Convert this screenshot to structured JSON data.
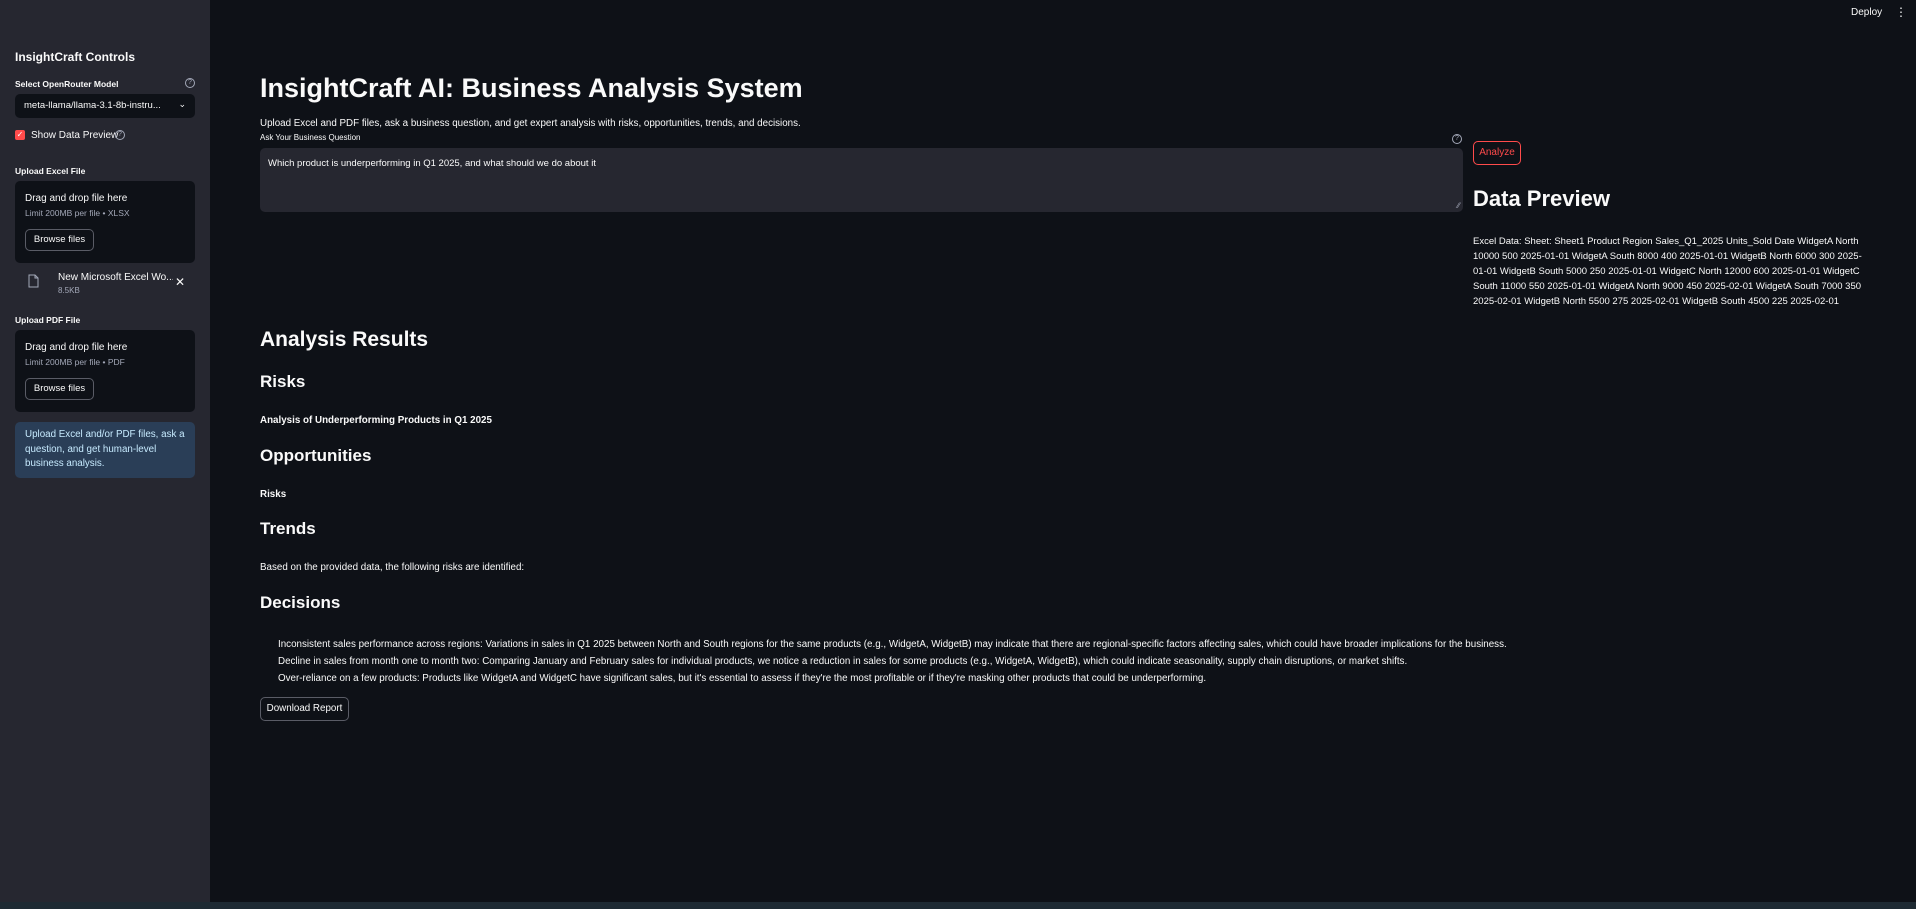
{
  "sidebar": {
    "title": "InsightCraft Controls",
    "model_label": "Select OpenRouter Model",
    "model_value": "meta-llama/llama-3.1-8b-instru...",
    "show_preview_label": "Show Data Preview",
    "show_preview_checked": true,
    "excel_label": "Upload Excel File",
    "excel_dropzone_title": "Drag and drop file here",
    "excel_dropzone_limit": "Limit 200MB per file • XLSX",
    "browse_label": "Browse files",
    "uploaded_file_name": "New Microsoft Excel Wo...",
    "uploaded_file_size": "8.5KB",
    "pdf_label": "Upload PDF File",
    "pdf_dropzone_title": "Drag and drop file here",
    "pdf_dropzone_limit": "Limit 200MB per file • PDF",
    "info_text": "Upload Excel and/or PDF files, ask a question, and get human-level business analysis."
  },
  "header": {
    "deploy_label": "Deploy"
  },
  "main": {
    "title": "InsightCraft AI: Business Analysis System",
    "subtitle": "Upload Excel and PDF files, ask a business question, and get expert analysis with risks, opportunities, trends, and decisions.",
    "question_label": "Ask Your Business Question",
    "question_value": "Which product is underperforming in Q1 2025, and what should we do about it",
    "analyze_label": "Analyze",
    "data_preview_title": "Data Preview",
    "data_preview_text": "Excel Data: Sheet: Sheet1 Product Region Sales_Q1_2025 Units_Sold Date WidgetA North 10000 500 2025-01-01 WidgetA South 8000 400 2025-01-01 WidgetB North 6000 300 2025-01-01 WidgetB South 5000 250 2025-01-01 WidgetC North 12000 600 2025-01-01 WidgetC South 11000 550 2025-01-01 WidgetA North 9000 450 2025-02-01 WidgetA South 7000 350 2025-02-01 WidgetB North 5500 275 2025-02-01 WidgetB South 4500 225 2025-02-01",
    "results_title": "Analysis Results",
    "risks_title": "Risks",
    "risks_text": "Analysis of Underperforming Products in Q1 2025",
    "opportunities_title": "Opportunities",
    "opportunities_text": "Risks",
    "trends_title": "Trends",
    "trends_text": "Based on the provided data, the following risks are identified:",
    "decisions_title": "Decisions",
    "decisions_items": [
      "Inconsistent sales performance across regions: Variations in sales in Q1 2025 between North and South regions for the same products (e.g., WidgetA, WidgetB) may indicate that there are regional-specific factors affecting sales, which could have broader implications for the business.",
      "Decline in sales from month one to month two: Comparing January and February sales for individual products, we notice a reduction in sales for some products (e.g., WidgetA, WidgetB), which could indicate seasonality, supply chain disruptions, or market shifts.",
      "Over-reliance on a few products: Products like WidgetA and WidgetC have significant sales, but it's essential to assess if they're the most profitable or if they're masking other products that could be underperforming."
    ],
    "download_label": "Download Report"
  },
  "colors": {
    "background": "#0e1117",
    "sidebar": "#262730",
    "accent": "#ff4b4b",
    "info_bg": "#1c3a55"
  }
}
